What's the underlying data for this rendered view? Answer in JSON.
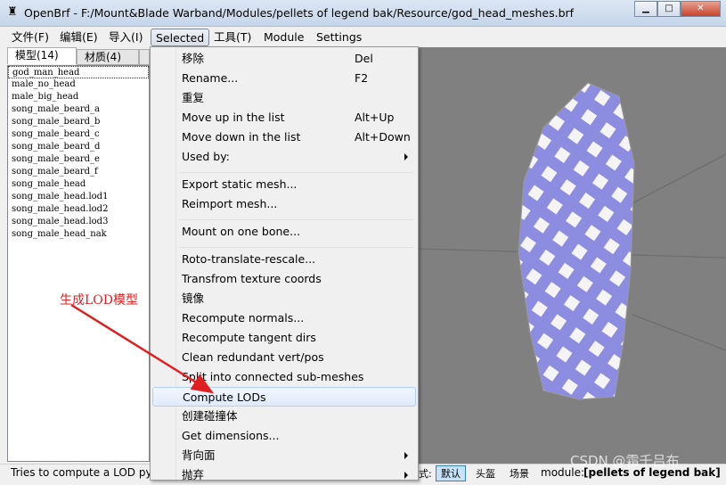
{
  "window": {
    "title": "OpenBrf - F:/Mount&Blade Warband/Modules/pellets of legend bak/Resource/god_head_meshes.brf",
    "min": "▁",
    "max": "□",
    "close": "✕"
  },
  "menubar": [
    "文件(F)",
    "编辑(E)",
    "导入(I)",
    "Selected",
    "工具(T)",
    "Module",
    "Settings"
  ],
  "tabs": [
    "模型(14)",
    "材质(4)"
  ],
  "meshes": [
    "god_man_head",
    "male_no_head",
    "male_big_head",
    "song_male_beard_a",
    "song_male_beard_b",
    "song_male_beard_c",
    "song_male_beard_d",
    "song_male_beard_e",
    "song_male_beard_f",
    "song_male_head",
    "song_male_head.lod1",
    "song_male_head.lod2",
    "song_male_head.lod3",
    "song_male_head_nak"
  ],
  "context_menu": [
    {
      "label": "移除",
      "key": "Del"
    },
    {
      "label": "Rename...",
      "key": "F2"
    },
    {
      "label": "重复"
    },
    {
      "label": "Move up in the list",
      "key": "Alt+Up"
    },
    {
      "label": "Move down in the list",
      "key": "Alt+Down"
    },
    {
      "label": "Used by:",
      "submenu": true
    },
    {
      "sep": true
    },
    {
      "label": "Export static mesh..."
    },
    {
      "label": "Reimport mesh..."
    },
    {
      "sep": true
    },
    {
      "label": "Mount on one bone..."
    },
    {
      "sep": true
    },
    {
      "label": "Roto-translate-rescale..."
    },
    {
      "label": "Transfrom texture coords"
    },
    {
      "label": "镜像"
    },
    {
      "label": "Recompute normals..."
    },
    {
      "label": "Recompute tangent dirs"
    },
    {
      "label": "Clean redundant vert/pos"
    },
    {
      "label": "Split into connected sub-meshes"
    },
    {
      "label": "Compute LODs",
      "highlighted": true
    },
    {
      "label": "创建碰撞体"
    },
    {
      "label": "Get dimensions..."
    },
    {
      "label": "背向面",
      "submenu": true
    },
    {
      "label": "抛弃",
      "submenu": true
    }
  ],
  "annotation": "生成LOD模型",
  "status": {
    "text": "Tries to compute a LOD py",
    "mode_label": "式:",
    "modes": [
      "默认",
      "头盔",
      "场景"
    ],
    "module_label": "module:",
    "module_name": "[pellets of legend bak]"
  },
  "watermark": "CSDN @霜千吕布",
  "colors": {
    "mesh_stripe": "#8c8ce0",
    "viewport": "#808080",
    "annotation": "#e02020"
  }
}
